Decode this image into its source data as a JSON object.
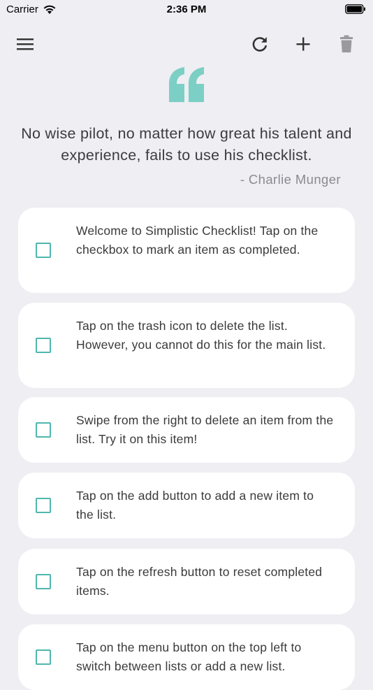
{
  "status_bar": {
    "carrier": "Carrier",
    "time": "2:36 PM"
  },
  "toolbar": {
    "menu_icon": "hamburger-menu-icon",
    "refresh_icon": "refresh-icon",
    "add_icon": "plus-icon",
    "trash_icon": "trash-icon"
  },
  "quote": {
    "text": "No wise pilot, no matter how great his talent and experience, fails to use his checklist.",
    "author": "- Charlie Munger"
  },
  "colors": {
    "accent": "#4fb7ad",
    "quote_mark": "#7ccfc4",
    "background": "#eeeef3",
    "card": "#ffffff",
    "disabled_icon": "#9a9a9e"
  },
  "items": [
    {
      "text": "Welcome to Simplistic Checklist! Tap on the checkbox to mark an item as completed.",
      "checked": false
    },
    {
      "text": "Tap on the trash icon to delete the list. However, you cannot do this for the main list.",
      "checked": false
    },
    {
      "text": "Swipe from the right to delete an item from the list. Try it on this item!",
      "checked": false
    },
    {
      "text": "Tap on the add button to add a new item to the list.",
      "checked": false
    },
    {
      "text": "Tap on the refresh button to reset completed items.",
      "checked": false
    },
    {
      "text": "Tap on the menu button on the top left to switch between lists or add a new list.",
      "checked": false
    }
  ]
}
